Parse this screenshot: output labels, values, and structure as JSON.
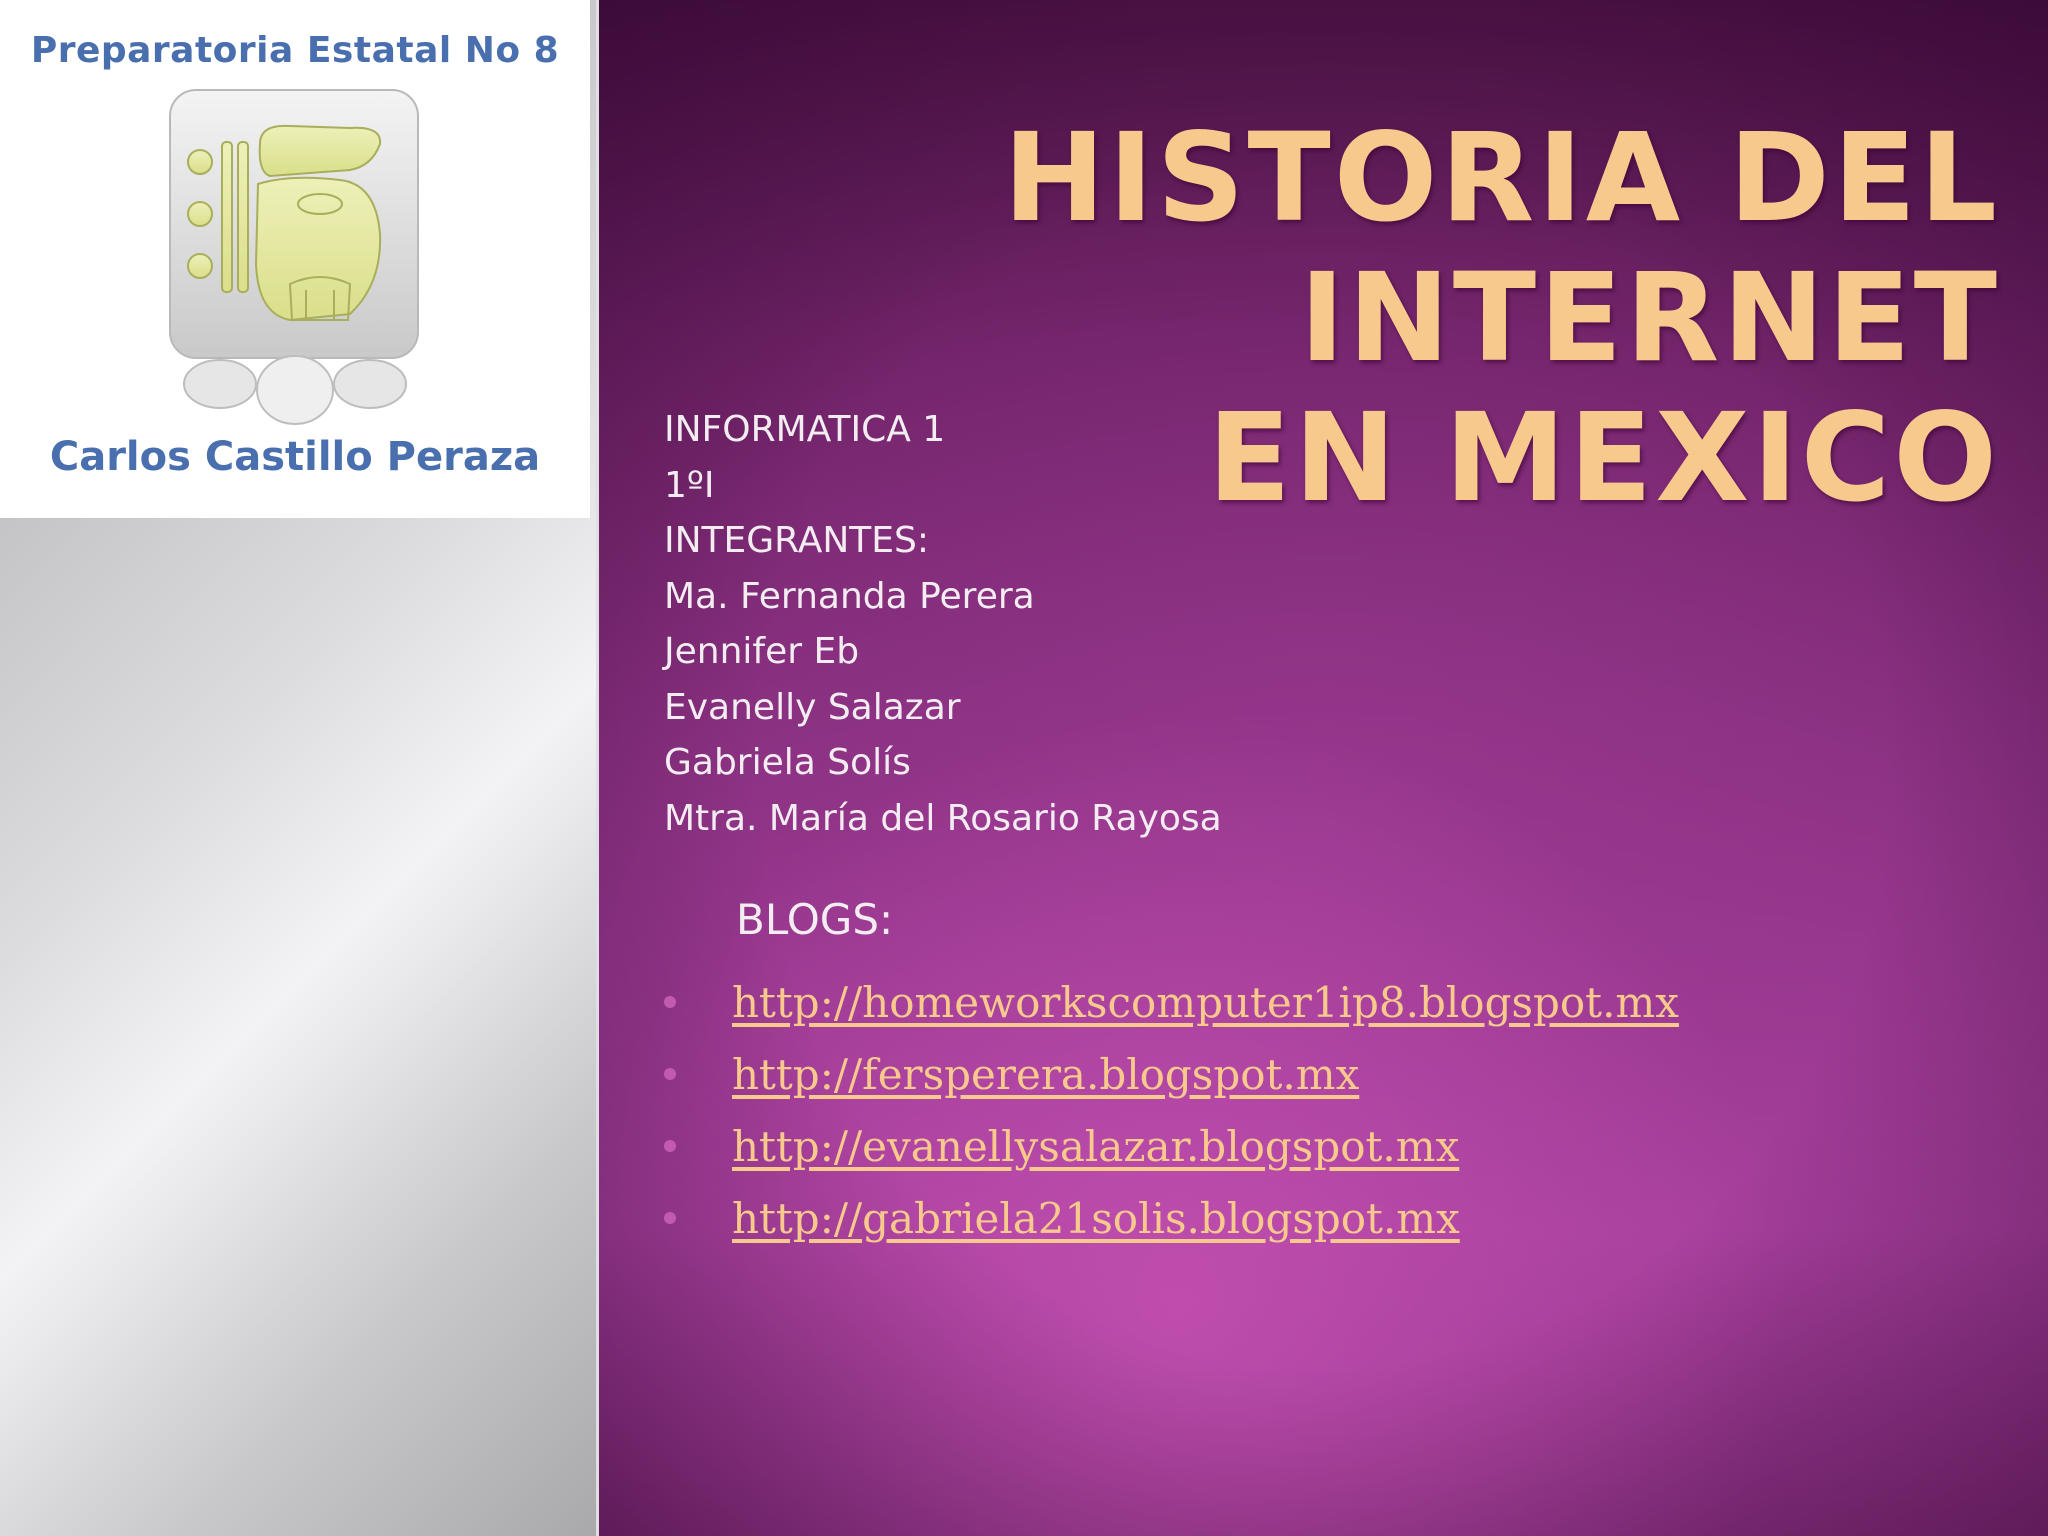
{
  "logo": {
    "top_text": "Preparatoria Estatal No 8",
    "bottom_text": "Carlos Castillo Peraza"
  },
  "title": {
    "line1": "Historia del Internet",
    "line2": "en Mexico"
  },
  "info": {
    "lines": [
      "INFORMATICA 1",
      "1ºI",
      "INTEGRANTES:",
      "Ma. Fernanda Perera",
      "Jennifer Eb",
      "Evanelly Salazar",
      "Gabriela Solís",
      "Mtra. María del Rosario Rayosa"
    ]
  },
  "blogs": {
    "heading": "BLOGS:",
    "links": [
      "http://homeworkscomputer1ip8.blogspot.mx",
      "http://fersperera.blogspot.mx",
      "http://evanellysalazar.blogspot.mx",
      "http://gabriela21solis.blogspot.mx"
    ]
  },
  "colors": {
    "title": "#f7c98d",
    "link": "#f7c98d",
    "logo_text": "#4a6fae",
    "background_purple": "#8f3386"
  }
}
